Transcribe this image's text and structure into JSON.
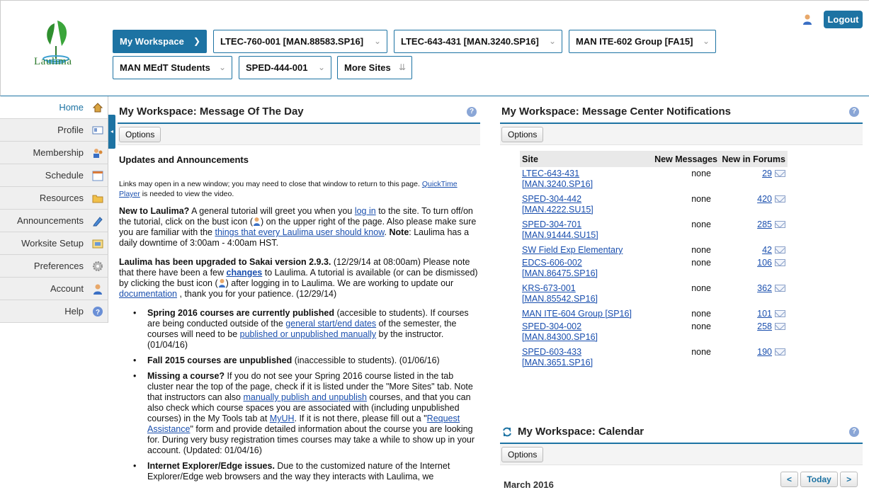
{
  "header": {
    "logo_text": "Laulima",
    "logout_label": "Logout",
    "user_icon": "bust-icon"
  },
  "site_tabs": [
    {
      "label": "My Workspace",
      "active": true
    },
    {
      "label": "LTEC-760-001 [MAN.88583.SP16]"
    },
    {
      "label": "LTEC-643-431 [MAN.3240.SP16]"
    },
    {
      "label": "MAN ITE-602 Group [FA15]"
    },
    {
      "label": "MAN MEdT Students"
    },
    {
      "label": "SPED-444-001"
    },
    {
      "label": "More Sites"
    }
  ],
  "nav": {
    "items": [
      {
        "label": "Home",
        "icon": "home-icon",
        "current": true
      },
      {
        "label": "Profile",
        "icon": "profile-card-icon"
      },
      {
        "label": "Membership",
        "icon": "membership-icon"
      },
      {
        "label": "Schedule",
        "icon": "calendar-icon"
      },
      {
        "label": "Resources",
        "icon": "folder-icon"
      },
      {
        "label": "Announcements",
        "icon": "pencil-icon"
      },
      {
        "label": "Worksite Setup",
        "icon": "worksite-icon"
      },
      {
        "label": "Preferences",
        "icon": "gear-icon"
      },
      {
        "label": "Account",
        "icon": "account-icon"
      },
      {
        "label": "Help",
        "icon": "help-icon"
      }
    ],
    "collapse_glyph": "◂"
  },
  "motd": {
    "title": "My Workspace: Message Of The Day",
    "options_label": "Options",
    "heading": "Updates and Announcements",
    "note_a": "Links may open in a new window; you may need to close that window to return to this page.",
    "note_link": "QuickTime Player",
    "note_b": "is needed to view the video.",
    "p1_bold": "New to Laulima?",
    "p1_a": "A general tutorial will greet you when you",
    "p1_link1": "log in",
    "p1_b": "to the site. To turn off/on the tutorial, click on the bust icon (",
    "p1_c": ") on the upper right of the page. Also please make sure you are familiar with the",
    "p1_link2": "things that every Laulima user should know",
    "p1_d": ".",
    "p1_note_bold": "Note",
    "p1_e": ": Laulima has a daily downtime of 3:00am - 4:00am HST.",
    "p2_bold": "Laulima has been upgraded to Sakai version 2.9.3.",
    "p2_a": "(12/29/14 at 08:00am) Please note that there have been a few",
    "p2_link1": "changes",
    "p2_b": "to Laulima. A tutorial is available (or can be dismissed) by clicking the bust icon (",
    "p2_c": ") after logging in to Laulima. We are working to update our",
    "p2_link2": "documentation",
    "p2_d": ", thank you for your patience. (12/29/14)",
    "b1_bold": "Spring 2016 courses are currently published",
    "b1_a": "(accesible to students).  If courses are being conducted outside of the",
    "b1_link1": "general start/end dates",
    "b1_b": "of the semester, the courses will need to be",
    "b1_link2": "published or unpublished manually",
    "b1_c": "by the instructor. (01/04/16)",
    "b2_bold": "Fall 2015 courses are unpublished",
    "b2_a": "(inaccessible to students). (01/06/16)",
    "b3_bold": "Missing a course?",
    "b3_a": "If you do not see your Spring 2016 course listed in the tab cluster near the top of the page, check if it is listed under the \"More Sites\" tab. Note that instructors can also",
    "b3_link1": "manually publish and unpublish",
    "b3_b": "courses, and that you can also check which course spaces you are associated with (including unpublished courses) in the My Tools tab at",
    "b3_link2": "MyUH",
    "b3_c": ". If it is not there, please fill out a \"",
    "b3_link3": "Request Assistance",
    "b3_d": "\" form and provide detailed information about the course you are looking for. During very busy registration times courses may take a while to show up in your account. (Updated: 01/04/16)",
    "b4_bold": "Internet Explorer/Edge issues.",
    "b4_a": "Due to the customized nature of the Internet Explorer/Edge web browsers and the way they interacts with Laulima, we"
  },
  "messages": {
    "title": "My Workspace: Message Center Notifications",
    "options_label": "Options",
    "columns": [
      "Site",
      "New Messages",
      "New in Forums"
    ],
    "rows": [
      {
        "site_l1": "LTEC-643-431",
        "site_l2": "[MAN.3240.SP16]",
        "new_messages": "none",
        "forums": "29"
      },
      {
        "site_l1": "SPED-304-442",
        "site_l2": "[MAN.4222.SU15]",
        "new_messages": "none",
        "forums": "420"
      },
      {
        "site_l1": "SPED-304-701",
        "site_l2": "[MAN.91444.SU15]",
        "new_messages": "none",
        "forums": "285"
      },
      {
        "site_l1": "SW Field Exp Elementary",
        "site_l2": "",
        "new_messages": "none",
        "forums": "42"
      },
      {
        "site_l1": "EDCS-606-002",
        "site_l2": "[MAN.86475.SP16]",
        "new_messages": "none",
        "forums": "106"
      },
      {
        "site_l1": "KRS-673-001",
        "site_l2": "[MAN.85542.SP16]",
        "new_messages": "none",
        "forums": "362"
      },
      {
        "site_l1": "MAN ITE-604 Group [SP16]",
        "site_l2": "",
        "new_messages": "none",
        "forums": "101"
      },
      {
        "site_l1": "SPED-304-002",
        "site_l2": "[MAN.84300.SP16]",
        "new_messages": "none",
        "forums": "258"
      },
      {
        "site_l1": "SPED-603-433",
        "site_l2": "[MAN.3651.SP16]",
        "new_messages": "none",
        "forums": "190"
      }
    ]
  },
  "calendar": {
    "title": "My Workspace: Calendar",
    "options_label": "Options",
    "prev": "<",
    "today": "Today",
    "next": ">",
    "month": "March 2016"
  },
  "help_glyph": "?",
  "colors": {
    "accent": "#1d73a3",
    "link": "#1a4fae"
  }
}
